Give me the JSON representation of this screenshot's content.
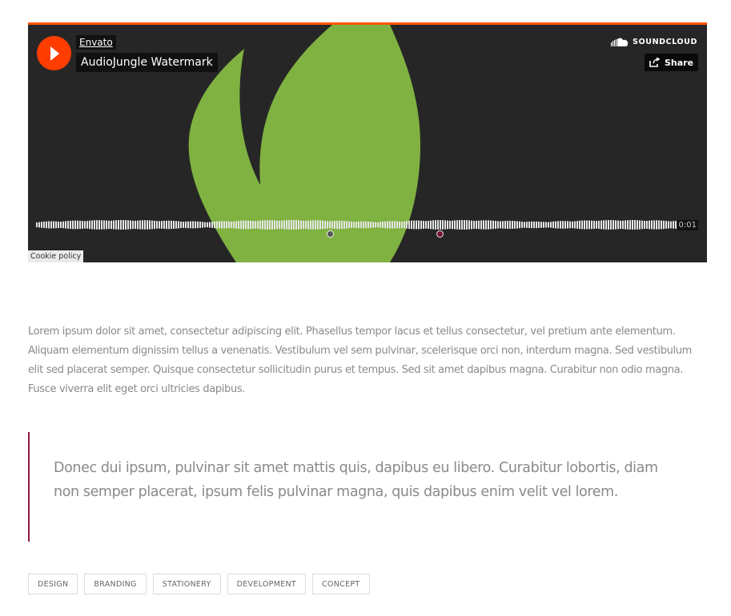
{
  "player": {
    "artist": "Envato",
    "title": "AudioJungle Watermark",
    "brand": "SOUNDCLOUD",
    "share_label": "Share",
    "time": "0:01",
    "cookie_label": "Cookie policy",
    "accent_color": "#ff5500",
    "artwork_color": "#7fb241",
    "icons": [
      "play-icon",
      "soundcloud-logo-icon",
      "share-icon"
    ]
  },
  "article": {
    "paragraph": "Lorem ipsum dolor sit amet, consectetur adipiscing elit. Phasellus tempor lacus et tellus consectetur, vel pretium ante elementum. Aliquam elementum dignissim tellus a venenatis. Vestibulum vel sem pulvinar, scelerisque orci non, interdum magna. Sed vestibulum elit sed placerat semper. Quisque consectetur sollicitudin purus et tempus. Sed sit amet dapibus magna. Curabitur non odio magna. Fusce viverra elit eget orci ultricies dapibus.",
    "quote": "Donec dui ipsum, pulvinar sit amet mattis quis, dapibus eu libero. Curabitur lobortis, diam non semper placerat, ipsum felis pulvinar magna, quis dapibus enim velit vel lorem.",
    "quote_border_color": "#8c1a3c"
  },
  "tags": [
    "DESIGN",
    "BRANDING",
    "STATIONERY",
    "DEVELOPMENT",
    "CONCEPT"
  ]
}
